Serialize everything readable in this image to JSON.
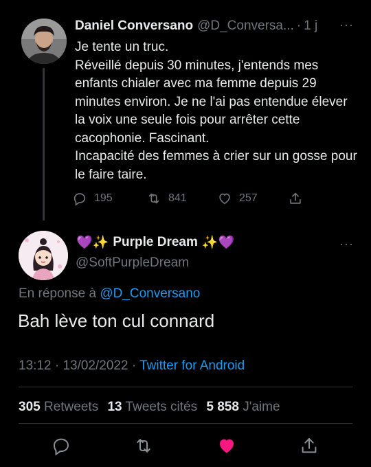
{
  "tweet1": {
    "author_name": "Daniel Conversano",
    "author_handle": "@D_Conversa...",
    "separator": "·",
    "age": "1 j",
    "lines": [
      "Je tente un truc.",
      "Réveillé depuis 30 minutes, j'entends mes enfants chialer avec ma femme depuis 29 minutes environ. Je ne l'ai pas entendue élever la voix une seule fois pour arrêter cette cacophonie. Fascinant.",
      "Incapacité des femmes à crier sur un gosse pour le faire taire."
    ],
    "replies": "195",
    "retweets": "841",
    "likes": "257"
  },
  "tweet2": {
    "author_name": "Purple Dream",
    "name_emoji_left": "💜✨",
    "name_emoji_right": "✨💜",
    "author_handle": "@SoftPurpleDream",
    "reply_prefix": "En réponse à",
    "reply_to": "@D_Conversano",
    "text": "Bah lève ton cul connard",
    "time": "13:12",
    "date_sep": "·",
    "date": "13/02/2022",
    "source_sep": "·",
    "source": "Twitter for Android",
    "stats": {
      "retweets_count": "305",
      "retweets_label": "Retweets",
      "quotes_count": "13",
      "quotes_label": "Tweets cités",
      "likes_count": "5 858",
      "likes_label": "J'aime"
    }
  },
  "colors": {
    "background": "#000000",
    "text": "#e7e9ea",
    "muted": "#71767b",
    "link": "#1d9bf0",
    "like_active": "#f91880"
  },
  "icons": [
    "reply-icon",
    "retweet-icon",
    "like-icon",
    "share-icon",
    "more-icon"
  ]
}
